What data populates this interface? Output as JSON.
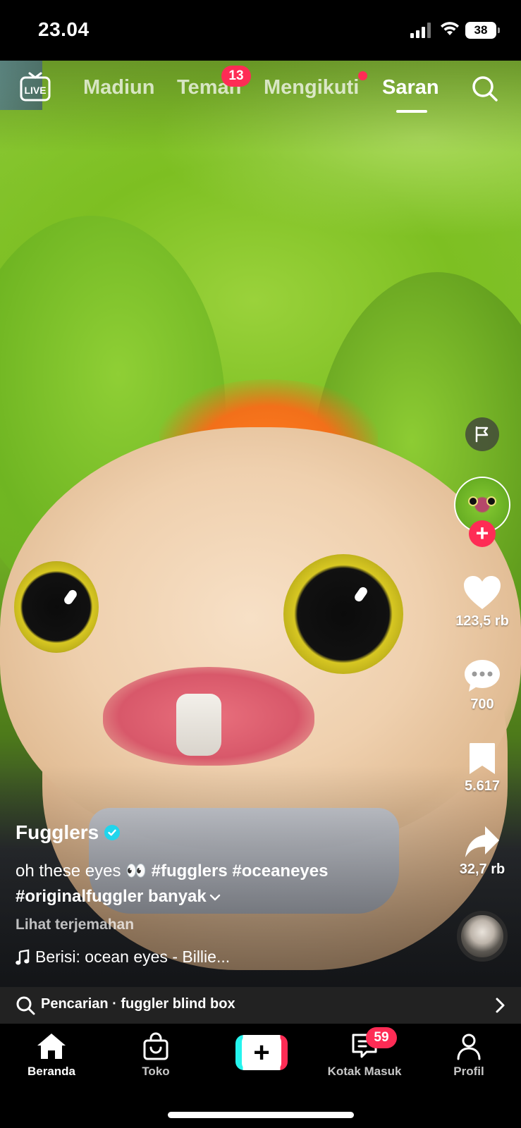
{
  "status_bar": {
    "time": "23.04",
    "battery": "38"
  },
  "top_nav": {
    "live_label": "LIVE",
    "tabs": [
      {
        "label": "Madiun"
      },
      {
        "label": "Teman",
        "badge": "13"
      },
      {
        "label": "Mengikuti"
      },
      {
        "label": "Saran",
        "active": true
      }
    ]
  },
  "right_rail": {
    "likes": "123,5 rb",
    "comments": "700",
    "saves": "5.617",
    "shares": "32,7 rb"
  },
  "caption": {
    "author": "Fugglers",
    "text": "oh these eyes 👀",
    "tags": [
      "#fugglers",
      "#oceaneyes",
      "#originalfuggler"
    ],
    "more_label": "banyak",
    "translate_label": "Lihat terjemahan",
    "music": "Berisi: ocean eyes - Billie..."
  },
  "search_suggestion": {
    "text": "Pencarian · fuggler blind box"
  },
  "bottom_nav": {
    "items": [
      {
        "label": "Beranda",
        "active": true
      },
      {
        "label": "Toko"
      },
      {
        "label": "+"
      },
      {
        "label": "Kotak Masuk",
        "badge": "59"
      },
      {
        "label": "Profil"
      }
    ]
  },
  "colors": {
    "accent": "#fe2c55",
    "cyan": "#25f4ee",
    "verified": "#20d5ec"
  }
}
